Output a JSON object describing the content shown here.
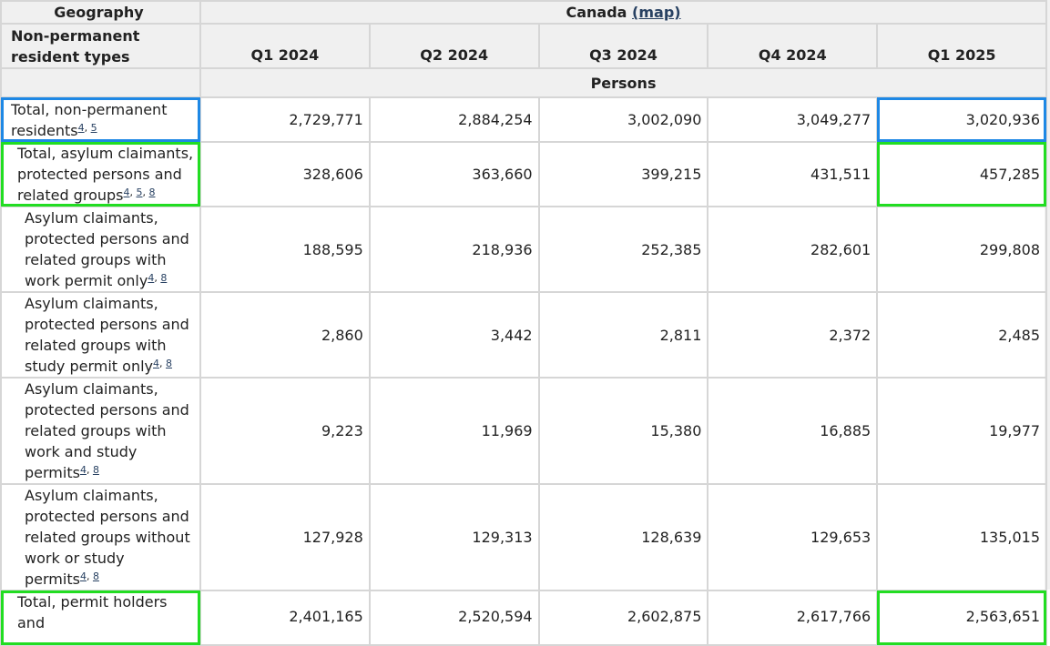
{
  "header": {
    "geography_label": "Geography",
    "geography_value": "Canada",
    "map_link": "(map)",
    "row_header_label": "Non-permanent resident types",
    "quarters": [
      "Q1 2024",
      "Q2 2024",
      "Q3 2024",
      "Q4 2024",
      "Q1 2025"
    ],
    "unit_label": "Persons"
  },
  "rows": [
    {
      "label": "Total, non-permanent residents",
      "footnotes": [
        "4",
        "5"
      ],
      "values": [
        "2,729,771",
        "2,884,254",
        "3,002,090",
        "3,049,277",
        "3,020,936"
      ]
    },
    {
      "label": "Total, asylum claimants, protected persons and related groups",
      "footnotes": [
        "4",
        "5",
        "8"
      ],
      "values": [
        "328,606",
        "363,660",
        "399,215",
        "431,511",
        "457,285"
      ]
    },
    {
      "label": "Asylum claimants, protected persons and related groups with work permit only",
      "footnotes": [
        "4",
        "8"
      ],
      "values": [
        "188,595",
        "218,936",
        "252,385",
        "282,601",
        "299,808"
      ]
    },
    {
      "label": "Asylum claimants, protected persons and related groups with study permit only",
      "footnotes": [
        "4",
        "8"
      ],
      "values": [
        "2,860",
        "3,442",
        "2,811",
        "2,372",
        "2,485"
      ]
    },
    {
      "label": "Asylum claimants, protected persons and related groups with work and study permits",
      "footnotes": [
        "4",
        "8"
      ],
      "values": [
        "9,223",
        "11,969",
        "15,380",
        "16,885",
        "19,977"
      ]
    },
    {
      "label": "Asylum claimants, protected persons and related groups without work or study permits",
      "footnotes": [
        "4",
        "8"
      ],
      "values": [
        "127,928",
        "129,313",
        "128,639",
        "129,653",
        "135,015"
      ]
    },
    {
      "label": "Total, permit holders and",
      "footnotes": [],
      "values": [
        "2,401,165",
        "2,520,594",
        "2,602,875",
        "2,617,766",
        "2,563,651"
      ]
    }
  ],
  "highlight_colors": {
    "blue": "#1e88e5",
    "green": "#22dd22"
  }
}
